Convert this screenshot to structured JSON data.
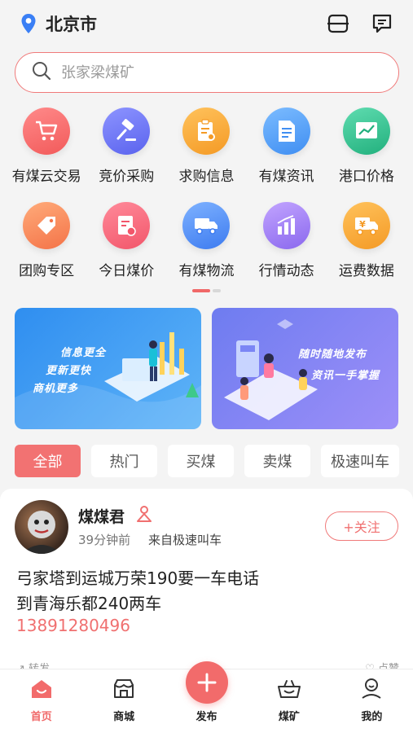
{
  "header": {
    "city": "北京市",
    "location_icon": "location-pin-icon",
    "scan_icon": "scan-icon",
    "message_icon": "message-icon"
  },
  "search": {
    "placeholder": "张家梁煤矿",
    "icon": "search-icon"
  },
  "categories_row1": [
    {
      "label": "有煤云交易",
      "icon": "cart-icon",
      "color": "#f26b6b"
    },
    {
      "label": "竞价采购",
      "icon": "gavel-icon",
      "color": "#6b73f0"
    },
    {
      "label": "求购信息",
      "icon": "clipboard-search-icon",
      "color": "#f5a430"
    },
    {
      "label": "有煤资讯",
      "icon": "document-icon",
      "color": "#4f9ff5"
    },
    {
      "label": "港口价格",
      "icon": "chart-icon",
      "color": "#33c08f"
    }
  ],
  "categories_row2": [
    {
      "label": "团购专区",
      "icon": "tag-icon",
      "color": "#f48a5c"
    },
    {
      "label": "今日煤价",
      "icon": "price-sheet-icon",
      "color": "#f26b6b"
    },
    {
      "label": "有煤物流",
      "icon": "truck-icon",
      "color": "#4f8ff5"
    },
    {
      "label": "行情动态",
      "icon": "bar-chart-icon",
      "color": "#9a7bf0"
    },
    {
      "label": "运费数据",
      "icon": "yen-truck-icon",
      "color": "#f5a430"
    }
  ],
  "banners": {
    "left": {
      "line1": "信息更全",
      "line2": "更新更快",
      "line3": "商机更多"
    },
    "right": {
      "line1": "随时随地发布",
      "line2": "资讯一手掌握"
    }
  },
  "filters": [
    "全部",
    "热门",
    "买煤",
    "卖煤",
    "极速叫车"
  ],
  "post": {
    "user": "煤煤君",
    "time": "39分钟前",
    "source": "来自极速叫车",
    "follow": "+关注",
    "line1": "弓家塔到运城万荣190要一车电话",
    "line2": "到青海乐都240两车",
    "phone": "13891280496",
    "share": "转发",
    "like": "点赞"
  },
  "tabbar": [
    {
      "label": "首页",
      "icon": "home-icon",
      "active": true
    },
    {
      "label": "商城",
      "icon": "store-icon",
      "active": false
    },
    {
      "label": "发布",
      "icon": "plus-icon",
      "active": false
    },
    {
      "label": "煤矿",
      "icon": "coal-basket-icon",
      "active": false
    },
    {
      "label": "我的",
      "icon": "profile-icon",
      "active": false
    }
  ],
  "colors": {
    "accent": "#f26b6b",
    "background": "#f4f4f4"
  }
}
